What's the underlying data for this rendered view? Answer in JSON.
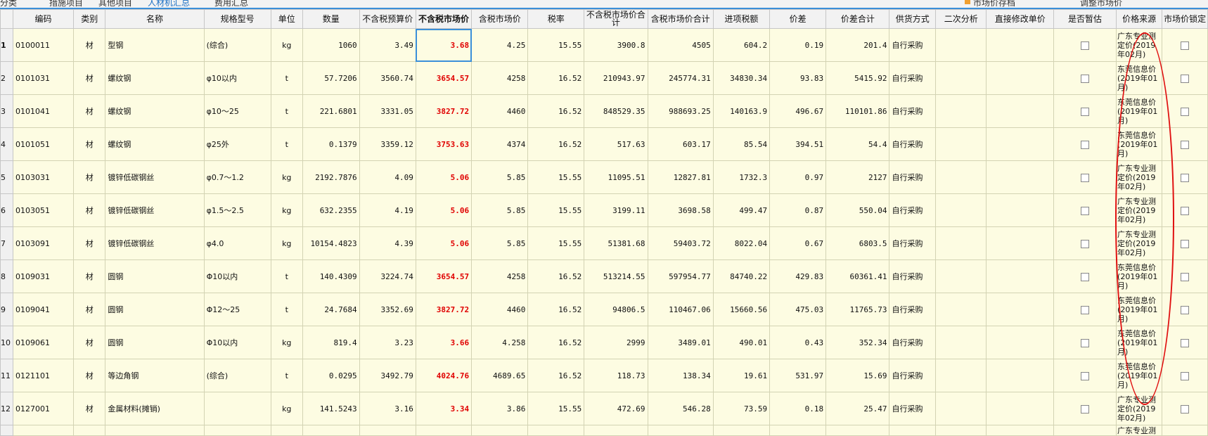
{
  "tabs": [
    {
      "label": "分类"
    },
    {
      "label": "措施项目"
    },
    {
      "label": "其他项目"
    },
    {
      "label": "人材机汇总",
      "active": true
    },
    {
      "label": "费用汇总"
    },
    {
      "label": "市场价存档"
    },
    {
      "label": "调整市场价"
    }
  ],
  "columns": [
    "",
    "编码",
    "类别",
    "名称",
    "规格型号",
    "单位",
    "数量",
    "不含税预算价",
    "不含税市场价",
    "含税市场价",
    "税率",
    "不含税市场价合计",
    "含税市场价合计",
    "进项税额",
    "价差",
    "价差合计",
    "供货方式",
    "二次分析",
    "直接修改单价",
    "是否暂估",
    "价格来源",
    "市场价锁定"
  ],
  "rows": [
    {
      "rn": "1",
      "code": "0100011",
      "type": "材",
      "name": "型钢",
      "spec": "(综合)",
      "unit": "kg",
      "qty": "1060",
      "budget": "3.49",
      "market": "3.68",
      "market_tax": "4.25",
      "rate": "15.55",
      "market_total": "3900.8",
      "tax_total": "4505",
      "input_tax": "604.2",
      "diff": "0.19",
      "diff_total": "201.4",
      "supply": "自行采购",
      "source": "广东专业测定价(2019年02月)"
    },
    {
      "rn": "2",
      "code": "0101031",
      "type": "材",
      "name": "螺纹钢",
      "spec": "φ10以内",
      "unit": "t",
      "qty": "57.7206",
      "budget": "3560.74",
      "market": "3654.57",
      "market_tax": "4258",
      "rate": "16.52",
      "market_total": "210943.97",
      "tax_total": "245774.31",
      "input_tax": "34830.34",
      "diff": "93.83",
      "diff_total": "5415.92",
      "supply": "自行采购",
      "source": "东莞信息价(2019年01月)"
    },
    {
      "rn": "3",
      "code": "0101041",
      "type": "材",
      "name": "螺纹钢",
      "spec": "φ10～25",
      "unit": "t",
      "qty": "221.6801",
      "budget": "3331.05",
      "market": "3827.72",
      "market_tax": "4460",
      "rate": "16.52",
      "market_total": "848529.35",
      "tax_total": "988693.25",
      "input_tax": "140163.9",
      "diff": "496.67",
      "diff_total": "110101.86",
      "supply": "自行采购",
      "source": "东莞信息价(2019年01月)"
    },
    {
      "rn": "4",
      "code": "0101051",
      "type": "材",
      "name": "螺纹钢",
      "spec": "φ25外",
      "unit": "t",
      "qty": "0.1379",
      "budget": "3359.12",
      "market": "3753.63",
      "market_tax": "4374",
      "rate": "16.52",
      "market_total": "517.63",
      "tax_total": "603.17",
      "input_tax": "85.54",
      "diff": "394.51",
      "diff_total": "54.4",
      "supply": "自行采购",
      "source": "东莞信息价(2019年01月)"
    },
    {
      "rn": "5",
      "code": "0103031",
      "type": "材",
      "name": "镀锌低碳钢丝",
      "spec": "φ0.7～1.2",
      "unit": "kg",
      "qty": "2192.7876",
      "budget": "4.09",
      "market": "5.06",
      "market_tax": "5.85",
      "rate": "15.55",
      "market_total": "11095.51",
      "tax_total": "12827.81",
      "input_tax": "1732.3",
      "diff": "0.97",
      "diff_total": "2127",
      "supply": "自行采购",
      "source": "广东专业测定价(2019年02月)"
    },
    {
      "rn": "6",
      "code": "0103051",
      "type": "材",
      "name": "镀锌低碳钢丝",
      "spec": "φ1.5～2.5",
      "unit": "kg",
      "qty": "632.2355",
      "budget": "4.19",
      "market": "5.06",
      "market_tax": "5.85",
      "rate": "15.55",
      "market_total": "3199.11",
      "tax_total": "3698.58",
      "input_tax": "499.47",
      "diff": "0.87",
      "diff_total": "550.04",
      "supply": "自行采购",
      "source": "广东专业测定价(2019年02月)"
    },
    {
      "rn": "7",
      "code": "0103091",
      "type": "材",
      "name": "镀锌低碳钢丝",
      "spec": "φ4.0",
      "unit": "kg",
      "qty": "10154.4823",
      "budget": "4.39",
      "market": "5.06",
      "market_tax": "5.85",
      "rate": "15.55",
      "market_total": "51381.68",
      "tax_total": "59403.72",
      "input_tax": "8022.04",
      "diff": "0.67",
      "diff_total": "6803.5",
      "supply": "自行采购",
      "source": "广东专业测定价(2019年02月)"
    },
    {
      "rn": "8",
      "code": "0109031",
      "type": "材",
      "name": "圆钢",
      "spec": "Φ10以内",
      "unit": "t",
      "qty": "140.4309",
      "budget": "3224.74",
      "market": "3654.57",
      "market_tax": "4258",
      "rate": "16.52",
      "market_total": "513214.55",
      "tax_total": "597954.77",
      "input_tax": "84740.22",
      "diff": "429.83",
      "diff_total": "60361.41",
      "supply": "自行采购",
      "source": "东莞信息价(2019年01月)"
    },
    {
      "rn": "9",
      "code": "0109041",
      "type": "材",
      "name": "圆钢",
      "spec": "Φ12～25",
      "unit": "t",
      "qty": "24.7684",
      "budget": "3352.69",
      "market": "3827.72",
      "market_tax": "4460",
      "rate": "16.52",
      "market_total": "94806.5",
      "tax_total": "110467.06",
      "input_tax": "15660.56",
      "diff": "475.03",
      "diff_total": "11765.73",
      "supply": "自行采购",
      "source": "东莞信息价(2019年01月)"
    },
    {
      "rn": "10",
      "code": "0109061",
      "type": "材",
      "name": "圆钢",
      "spec": "Φ10以内",
      "unit": "kg",
      "qty": "819.4",
      "budget": "3.23",
      "market": "3.66",
      "market_tax": "4.258",
      "rate": "16.52",
      "market_total": "2999",
      "tax_total": "3489.01",
      "input_tax": "490.01",
      "diff": "0.43",
      "diff_total": "352.34",
      "supply": "自行采购",
      "source": "东莞信息价(2019年01月)"
    },
    {
      "rn": "11",
      "code": "0121101",
      "type": "材",
      "name": "等边角钢",
      "spec": "(综合)",
      "unit": "t",
      "qty": "0.0295",
      "budget": "3492.79",
      "market": "4024.76",
      "market_tax": "4689.65",
      "rate": "16.52",
      "market_total": "118.73",
      "tax_total": "138.34",
      "input_tax": "19.61",
      "diff": "531.97",
      "diff_total": "15.69",
      "supply": "自行采购",
      "source": "东莞信息价(2019年01月)"
    },
    {
      "rn": "12",
      "code": "0127001",
      "type": "材",
      "name": "金属材料(摊销)",
      "spec": "",
      "unit": "kg",
      "qty": "141.5243",
      "budget": "3.16",
      "market": "3.34",
      "market_tax": "3.86",
      "rate": "15.55",
      "market_total": "472.69",
      "tax_total": "546.28",
      "input_tax": "73.59",
      "diff": "0.18",
      "diff_total": "25.47",
      "supply": "自行采购",
      "source": "广东专业测定价(2019年02月)"
    }
  ],
  "partial_row_source": "广东专业测",
  "colors": {
    "header_bg": "#f2f2f2",
    "row_bg": "#fdfce2",
    "accent_red": "#e00000",
    "selection": "#3b8fd9",
    "annotation_ellipse": "#e01010"
  }
}
